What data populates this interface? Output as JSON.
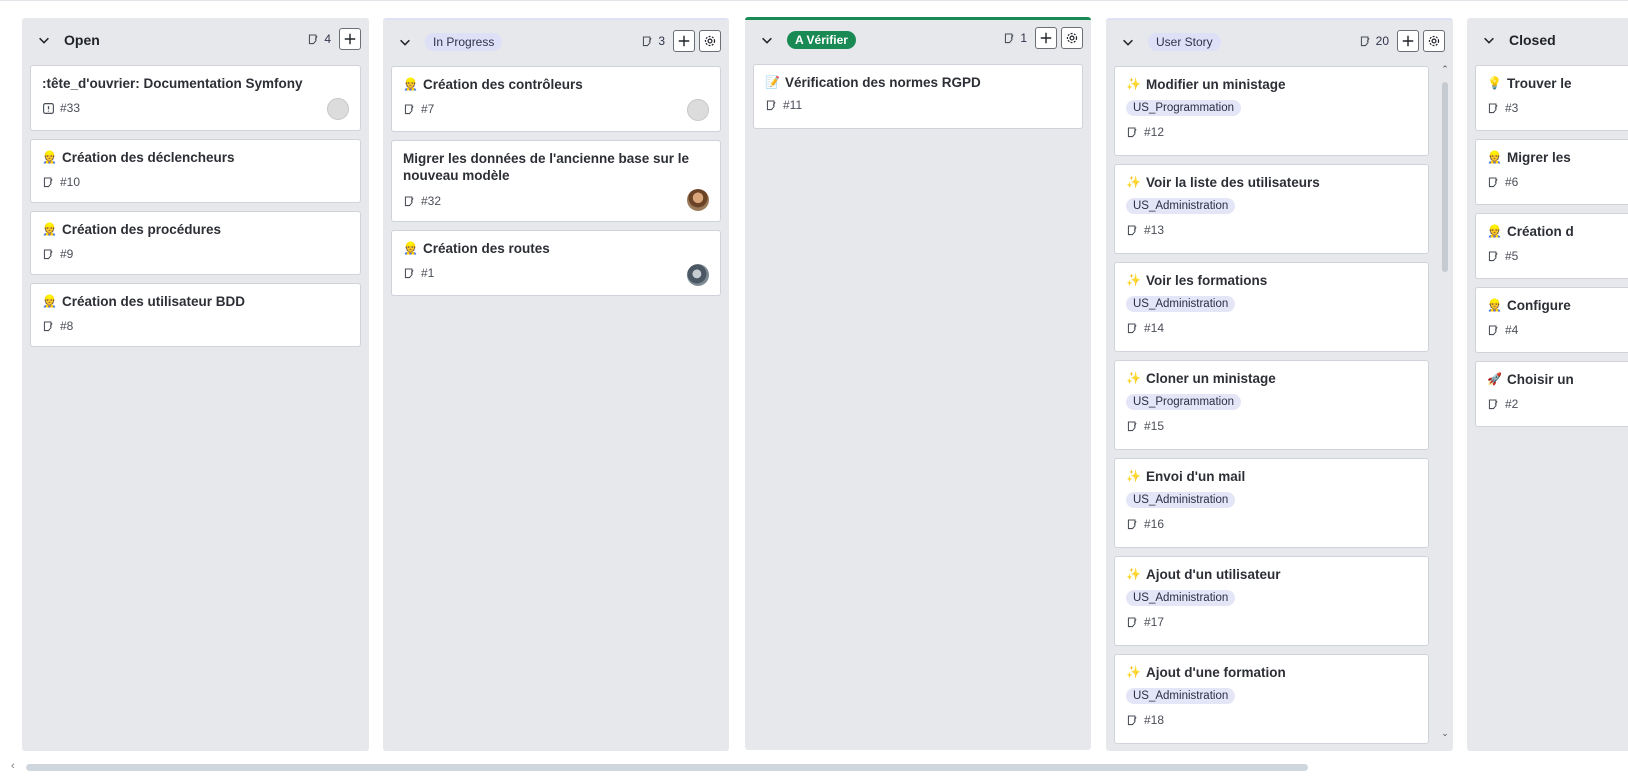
{
  "columns": [
    {
      "title": "Open",
      "count": "4",
      "cards": [
        {
          "title": ":tête_d'ouvrier: Documentation Symfony",
          "emoji": "",
          "number": "#33",
          "icon": "issue-open-icon",
          "avatar": "blank"
        },
        {
          "title": "Création des déclencheurs",
          "emoji": "👷",
          "number": "#10",
          "icon": "note-icon",
          "avatar": ""
        },
        {
          "title": "Création des procédures",
          "emoji": "👷",
          "number": "#9",
          "icon": "note-icon",
          "avatar": ""
        },
        {
          "title": "Création des utilisateur BDD",
          "emoji": "👷",
          "number": "#8",
          "icon": "note-icon",
          "avatar": ""
        }
      ]
    },
    {
      "title": "In Progress",
      "count": "3",
      "cards": [
        {
          "title": "Création des contrôleurs",
          "emoji": "👷",
          "number": "#7",
          "avatar": "blank"
        },
        {
          "title": "Migrer les données de l'ancienne base sur le nouveau modèle",
          "emoji": "",
          "number": "#32",
          "avatar": "photo1"
        },
        {
          "title": "Création des routes",
          "emoji": "👷",
          "number": "#1",
          "avatar": "photo2"
        }
      ]
    },
    {
      "title": "A Vérifier",
      "count": "1",
      "cards": [
        {
          "title": "Vérification des normes RGPD",
          "emoji": "📝",
          "number": "#11",
          "avatar": ""
        }
      ]
    },
    {
      "title": "User Story",
      "count": "20",
      "cards": [
        {
          "title": "Modifier un ministage",
          "emoji": "✨",
          "tag": "US_Programmation",
          "number": "#12"
        },
        {
          "title": "Voir la liste des utilisateurs",
          "emoji": "✨",
          "tag": "US_Administration",
          "number": "#13"
        },
        {
          "title": "Voir les formations",
          "emoji": "✨",
          "tag": "US_Administration",
          "number": "#14"
        },
        {
          "title": "Cloner un ministage",
          "emoji": "✨",
          "tag": "US_Programmation",
          "number": "#15"
        },
        {
          "title": "Envoi d'un mail",
          "emoji": "✨",
          "tag": "US_Administration",
          "number": "#16"
        },
        {
          "title": "Ajout d'un utilisateur",
          "emoji": "✨",
          "tag": "US_Administration",
          "number": "#17"
        },
        {
          "title": "Ajout d'une formation",
          "emoji": "✨",
          "tag": "US_Administration",
          "number": "#18"
        }
      ]
    },
    {
      "title": "Closed",
      "cards": [
        {
          "title": "Trouver le",
          "emoji": "💡",
          "number": "#3"
        },
        {
          "title": "Migrer les",
          "emoji": "👷",
          "number": "#6"
        },
        {
          "title": "Création d",
          "emoji": "👷",
          "number": "#5"
        },
        {
          "title": "Configure",
          "emoji": "👷",
          "number": "#4"
        },
        {
          "title": "Choisir un",
          "emoji": "🚀",
          "number": "#2"
        }
      ]
    }
  ],
  "colors": {
    "column_bg": "#e7e8ec",
    "accent_green": "#1a8a54",
    "pill_lavender": "#dde0f6",
    "card_border": "#d0d3da"
  }
}
